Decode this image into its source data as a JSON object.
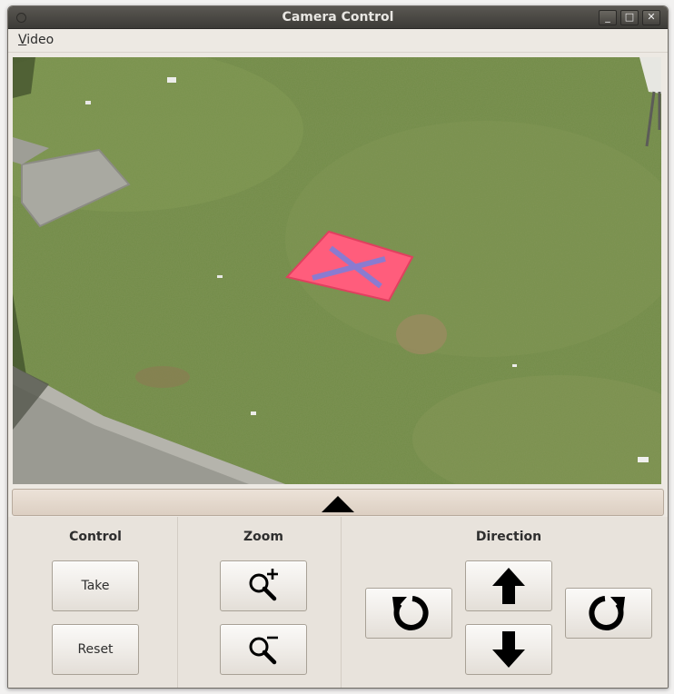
{
  "window": {
    "title": "Camera Control",
    "minimize": "_",
    "maximize": "□",
    "close": "✕"
  },
  "menu": {
    "video_first": "V",
    "video_rest": "ideo"
  },
  "panel": {
    "control": {
      "label": "Control",
      "take": "Take",
      "reset": "Reset"
    },
    "zoom": {
      "label": "Zoom"
    },
    "direction": {
      "label": "Direction"
    }
  },
  "icons": {
    "zoom_in": "zoom-in-icon",
    "zoom_out": "zoom-out-icon",
    "rotate_left": "rotate-left-icon",
    "rotate_right": "rotate-right-icon",
    "up": "arrow-up-icon",
    "down": "arrow-down-icon",
    "collapse": "triangle-up-icon"
  },
  "colors": {
    "titlebar": "#3c3b37",
    "target": "#ff5a78",
    "grass": "#728c48"
  }
}
